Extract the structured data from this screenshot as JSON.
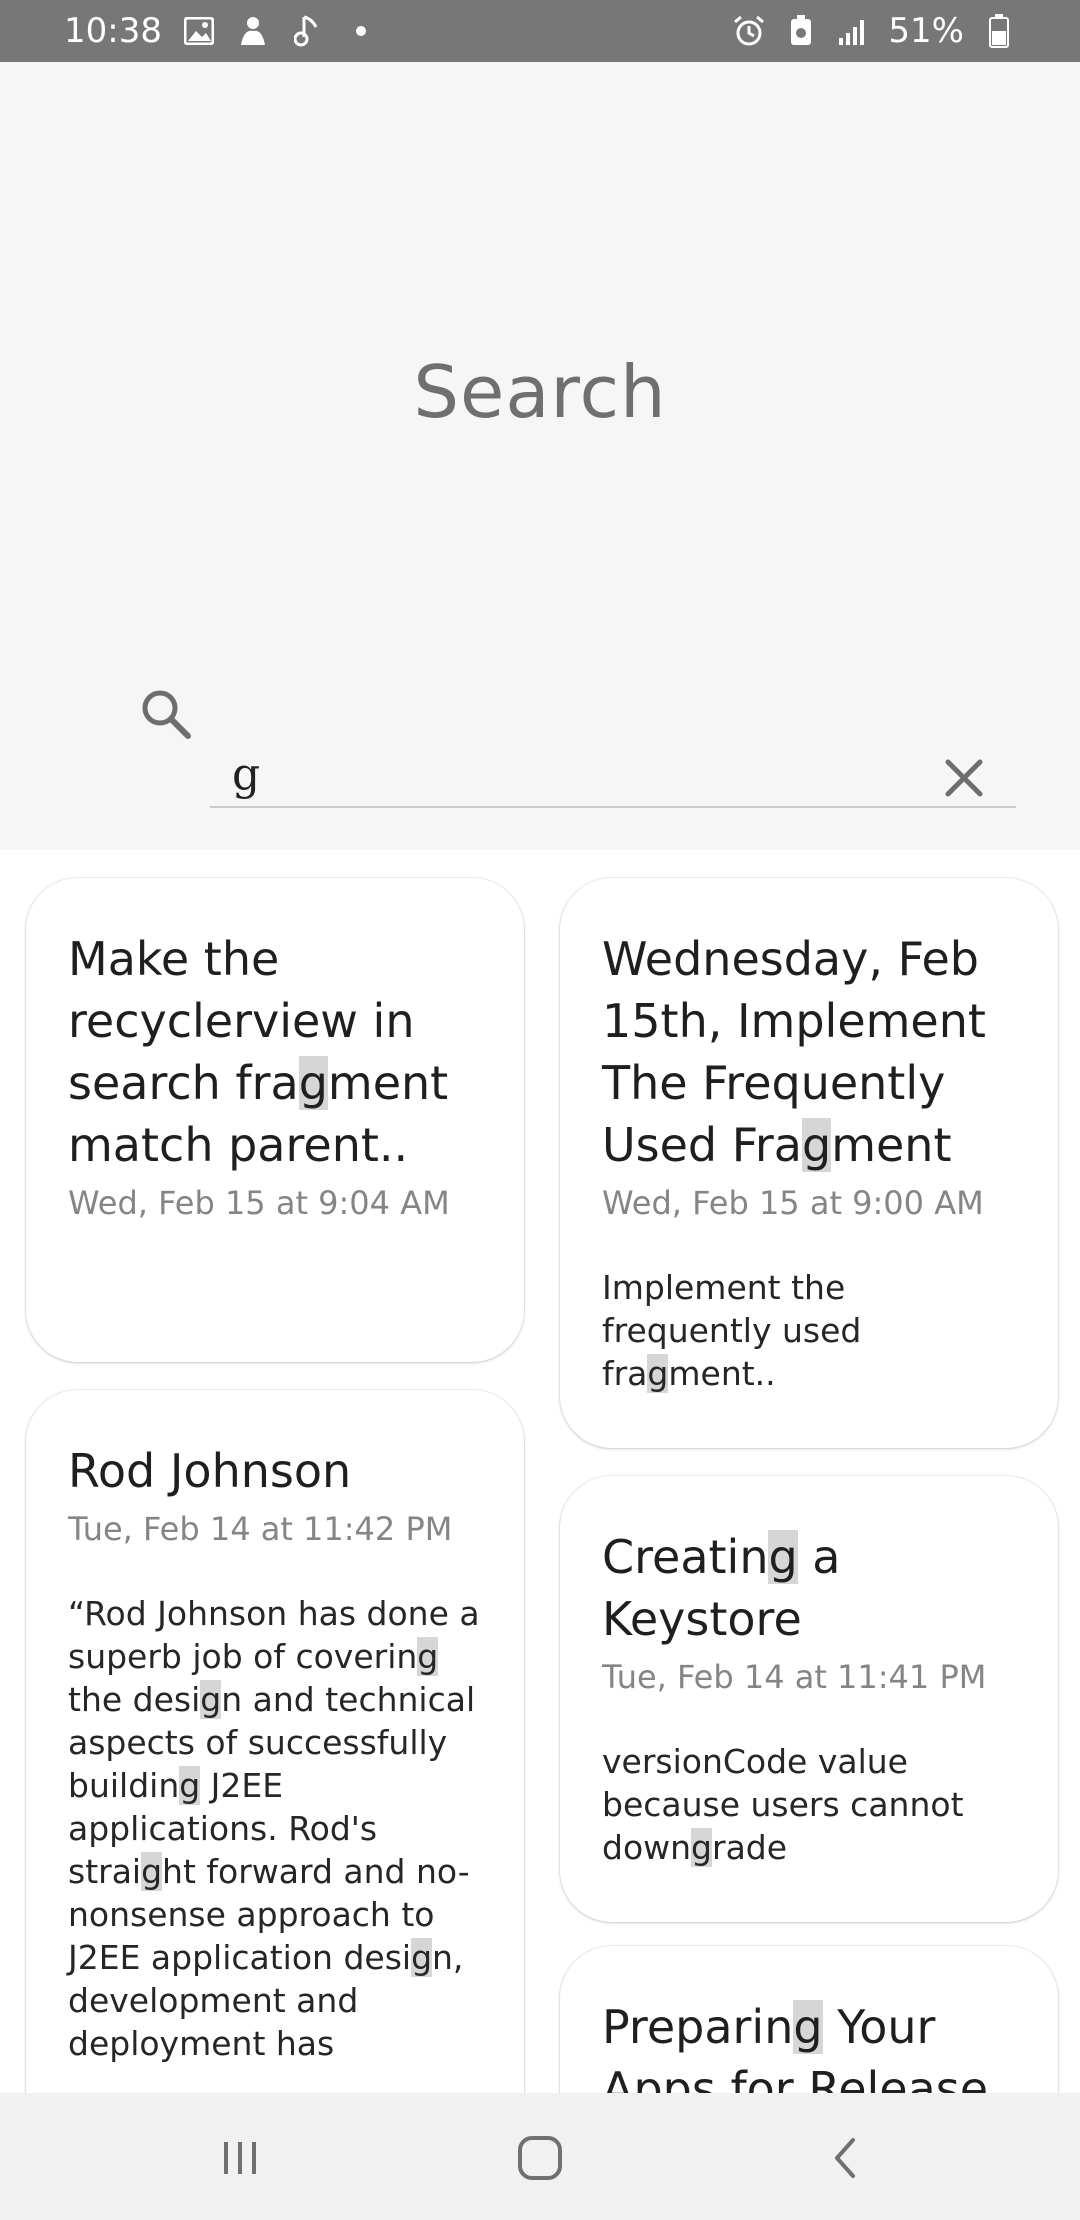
{
  "status_bar": {
    "time": "10:38",
    "battery": "51%",
    "left_icons": [
      "gallery-icon",
      "notification-app-icon",
      "music-note-icon",
      "dot-icon"
    ],
    "right_icons": [
      "alarm-icon",
      "battery-saver-icon",
      "signal-icon",
      "battery-icon"
    ]
  },
  "header": {
    "title": "Search"
  },
  "search": {
    "query": "g",
    "query_highlight": "g"
  },
  "results": [
    {
      "title_parts": [
        "Make the recyclerview in search fra",
        "g",
        "ment match parent.."
      ],
      "date": "Wed, Feb 15 at 9:04 AM",
      "body_parts": []
    },
    {
      "title_parts": [
        "Wednesday, Feb 15th, Implement The Frequently Used Fra",
        "g",
        "ment"
      ],
      "date": "Wed, Feb 15 at 9:00 AM",
      "body_parts": [
        "Implement the frequently used fra",
        "g",
        "ment.."
      ]
    },
    {
      "title_parts": [
        "Rod Johnson"
      ],
      "date": "Tue, Feb 14 at 11:42 PM",
      "body_parts": [
        "“Rod Johnson has done a superb job of coverin",
        "g",
        " the desi",
        "g",
        "n and technical aspects of successfully buildin",
        "g",
        " J2EE applications. Rod's strai",
        "g",
        "ht forward and no-nonsense approach to J2EE application desi",
        "g",
        "n, development and deployment has"
      ]
    },
    {
      "title_parts": [
        "Creatin",
        "g",
        " a Keystore"
      ],
      "date": "Tue, Feb 14 at 11:41 PM",
      "body_parts": [
        "versionCode value because users cannot down",
        "g",
        "rade"
      ]
    },
    {
      "title_parts": [
        "Preparin",
        "g",
        " Your Apps for Release"
      ],
      "date": "",
      "body_parts": []
    }
  ],
  "nav_bar": {
    "buttons": [
      "recent-apps-icon",
      "home-icon",
      "back-icon"
    ]
  },
  "colors": {
    "status_bar": "#777777",
    "header_bg": "#f6f6f6",
    "highlight": "#d6d6d6",
    "title_text": "#6f6f6f"
  }
}
